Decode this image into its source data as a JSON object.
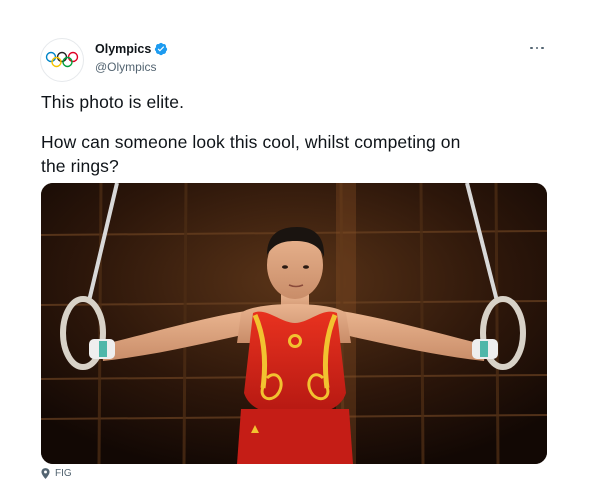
{
  "author": {
    "display_name": "Olympics",
    "handle": "@Olympics",
    "verified": true,
    "avatar_icon": "olympic-rings-icon"
  },
  "tweet": {
    "line1": "This photo is elite.",
    "line2": "How can someone look this cool, whilst competing on",
    "line3": "the rings?"
  },
  "media": {
    "alt": "Gymnast in a red and gold leotard holding still rings with arms extended"
  },
  "footer": {
    "location_icon": "location-pin-icon",
    "label": "FIG"
  },
  "colors": {
    "verified_blue": "#1d9bf0",
    "text_primary": "#0f1419",
    "text_secondary": "#536471",
    "leotard_red": "#d8231b",
    "leotard_gold": "#f2c230"
  }
}
